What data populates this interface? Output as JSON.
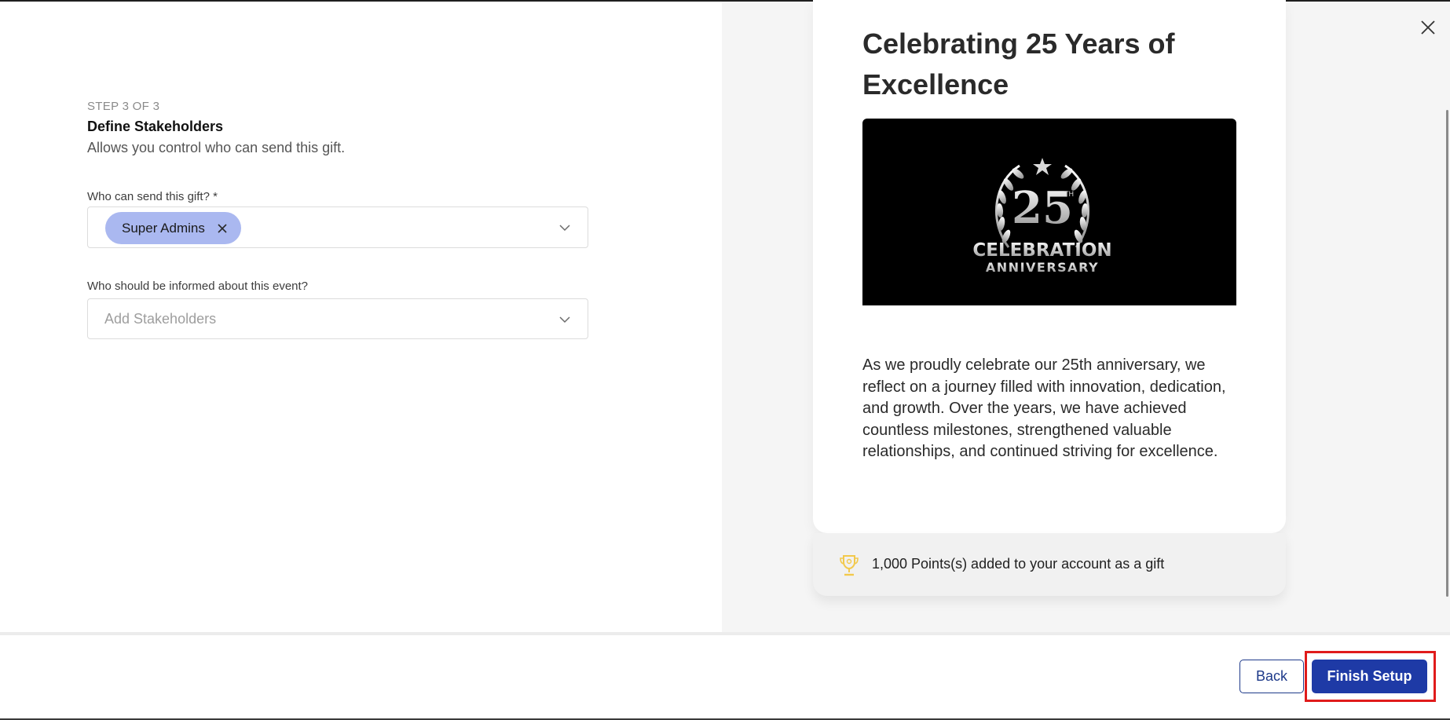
{
  "form": {
    "step_label": "STEP 3 OF 3",
    "title": "Define Stakeholders",
    "description": "Allows you control who can send this gift.",
    "senders_field": {
      "label": "Who can send this gift? *",
      "selected": [
        "Super Admins"
      ]
    },
    "stakeholders_field": {
      "label": "Who should be informed about this event?",
      "placeholder": "Add Stakeholders"
    }
  },
  "preview": {
    "title": "Celebrating 25 Years of Excellence",
    "image": {
      "number": "25",
      "superscript": "TH",
      "line1": "CELEBRATION",
      "line2": "ANNIVERSARY"
    },
    "message": "As we proudly celebrate our 25th anniversary, we reflect on a journey filled with innovation, dedication, and growth. Over the years, we have achieved countless milestones, strengthened valuable relationships, and continued striving for excellence.",
    "points_note": "1,000 Points(s) added to your account as a gift",
    "points_icon": "trophy-icon"
  },
  "footer": {
    "back_label": "Back",
    "finish_label": "Finish Setup"
  },
  "colors": {
    "primary": "#1e3aa6",
    "chip": "#aab8f0",
    "highlight": "#e01b1b",
    "trophy": "#f2c94c"
  }
}
